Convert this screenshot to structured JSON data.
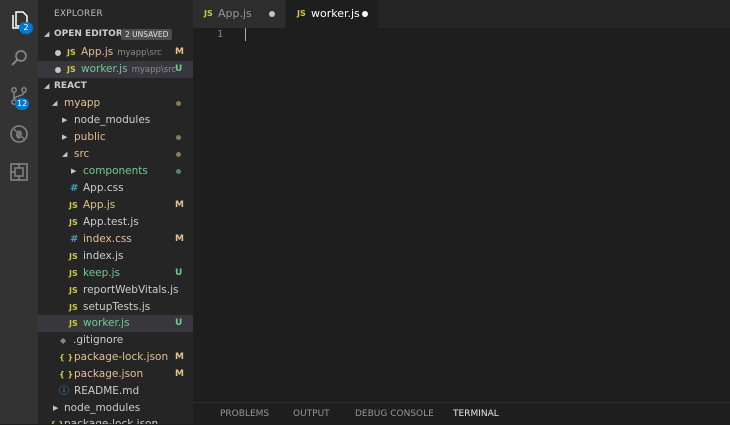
{
  "activity_bar": {
    "explorer_badge": "2",
    "scm_badge": "12"
  },
  "sidebar": {
    "title": "EXPLORER",
    "open_editors": {
      "title": "OPEN EDITORS",
      "badge": "2 UNSAVED",
      "items": [
        {
          "icon": "JS",
          "name": "App.js",
          "path": "myapp\\src",
          "status": "M"
        },
        {
          "icon": "JS",
          "name": "worker.js",
          "path": "myapp\\src",
          "status": "U"
        }
      ]
    },
    "project": {
      "title": "REACT",
      "tree": [
        {
          "icon": "",
          "name": "myapp",
          "status": ""
        },
        {
          "icon": "",
          "name": "node_modules",
          "status": ""
        },
        {
          "icon": "",
          "name": "public",
          "status": ""
        },
        {
          "icon": "",
          "name": "src",
          "status": ""
        },
        {
          "icon": "",
          "name": "components",
          "status": ""
        },
        {
          "icon": "#",
          "name": "App.css",
          "status": ""
        },
        {
          "icon": "JS",
          "name": "App.js",
          "status": "M"
        },
        {
          "icon": "JS",
          "name": "App.test.js",
          "status": ""
        },
        {
          "icon": "#",
          "name": "index.css",
          "status": "M"
        },
        {
          "icon": "JS",
          "name": "index.js",
          "status": ""
        },
        {
          "icon": "JS",
          "name": "keep.js",
          "status": "U"
        },
        {
          "icon": "JS",
          "name": "reportWebVitals.js",
          "status": ""
        },
        {
          "icon": "JS",
          "name": "setupTests.js",
          "status": ""
        },
        {
          "icon": "JS",
          "name": "worker.js",
          "status": "U"
        },
        {
          "icon": "",
          "name": ".gitignore",
          "status": ""
        },
        {
          "icon": "{ }",
          "name": "package-lock.json",
          "status": "M"
        },
        {
          "icon": "{ }",
          "name": "package.json",
          "status": "M"
        },
        {
          "icon": "ⓘ",
          "name": "README.md",
          "status": ""
        },
        {
          "icon": "",
          "name": "node_modules",
          "status": ""
        },
        {
          "icon": "{ }",
          "name": "package-lock.json",
          "status": ""
        }
      ]
    }
  },
  "tabs": [
    {
      "icon": "JS",
      "label": "App.js"
    },
    {
      "icon": "JS",
      "label": "worker.js"
    }
  ],
  "editor": {
    "line_number": "1"
  },
  "panel": {
    "tabs": [
      "PROBLEMS",
      "OUTPUT",
      "DEBUG CONSOLE",
      "TERMINAL"
    ]
  },
  "colors": {
    "accent": "#007acc",
    "modified": "#e2c08d",
    "untracked": "#73c991",
    "js_icon": "#cbcb41",
    "css_icon": "#519aba"
  }
}
